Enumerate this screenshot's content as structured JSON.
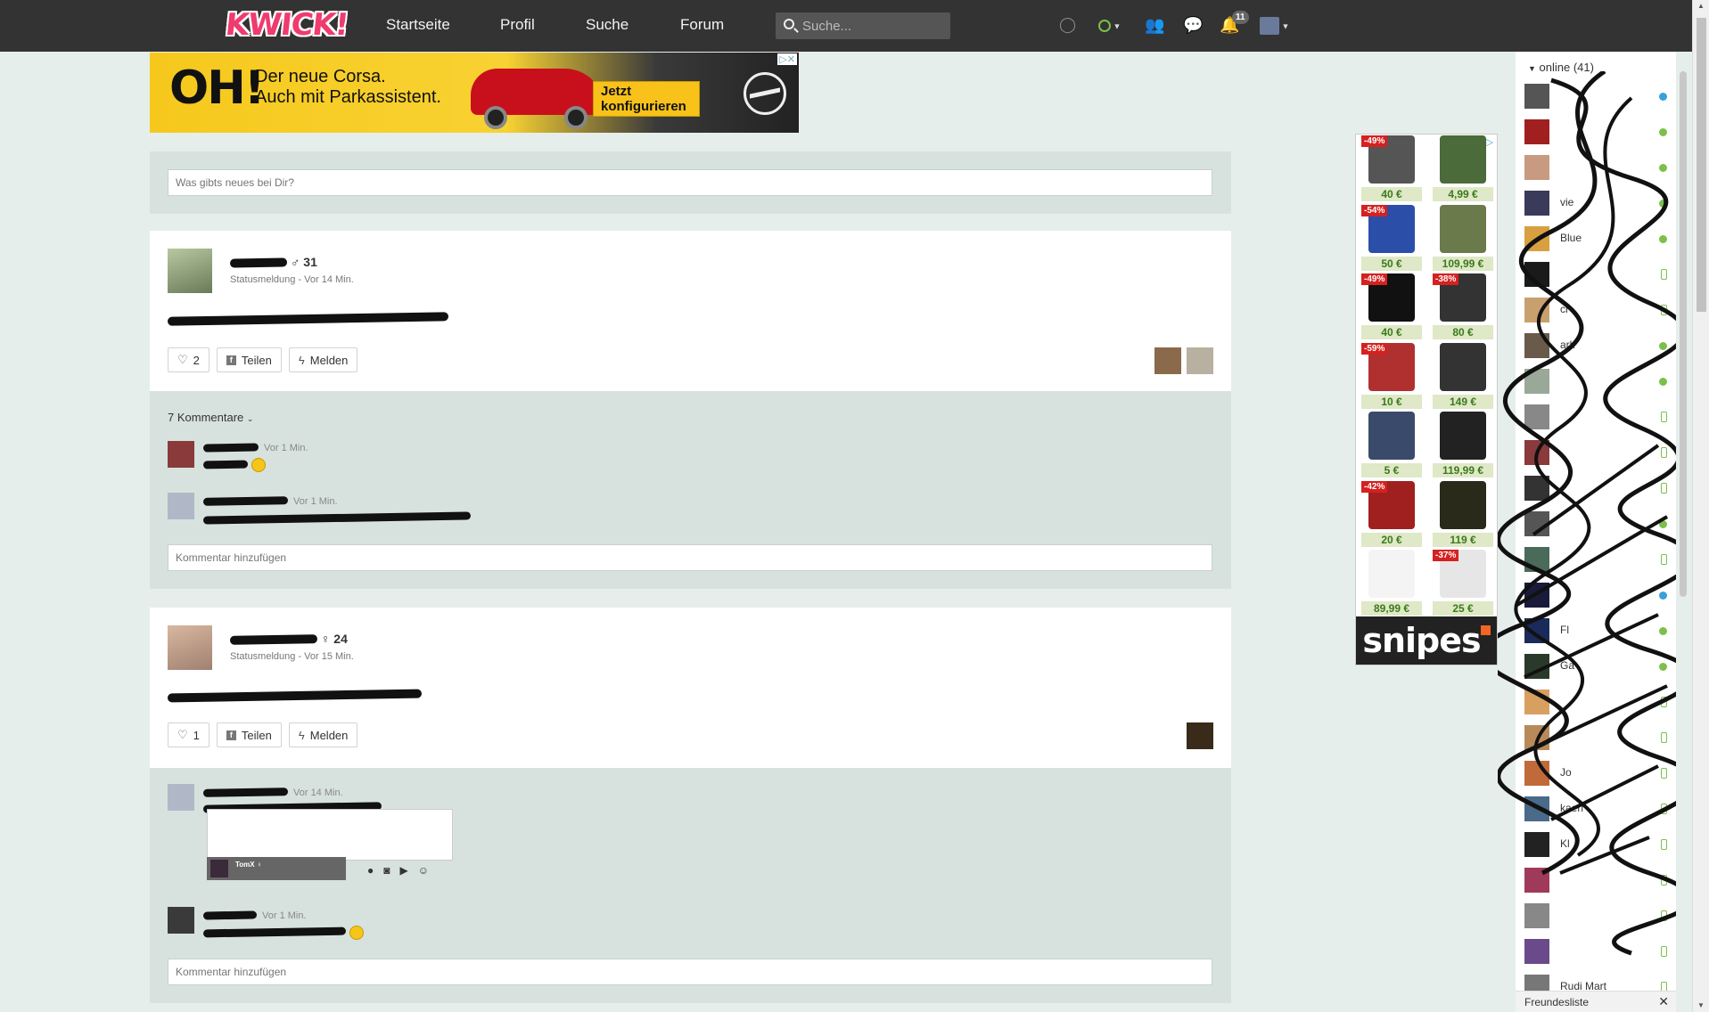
{
  "header": {
    "logo": "KWICK!",
    "nav": [
      "Startseite",
      "Profil",
      "Suche",
      "Forum"
    ],
    "search_placeholder": "Suche...",
    "notification_count": "11"
  },
  "ad_banner": {
    "headline": "OH!",
    "line1": "Der neue Corsa.",
    "line2": "Auch mit Parkassistent.",
    "cta": "Jetzt konfigurieren"
  },
  "compose": {
    "placeholder": "Was gibts neues bei Dir?"
  },
  "posts": [
    {
      "gender": "♂",
      "age": "31",
      "meta": "Statusmeldung - Vor 14 Min.",
      "likes": "2",
      "share_label": "Teilen",
      "report_label": "Melden",
      "comment_count": "7 Kommentare",
      "comments": [
        {
          "time": "Vor 1 Min."
        },
        {
          "time": "Vor 1 Min."
        }
      ],
      "comment_placeholder": "Kommentar hinzufügen"
    },
    {
      "gender": "♀",
      "age": "24",
      "meta": "Statusmeldung - Vor 15 Min.",
      "likes": "1",
      "share_label": "Teilen",
      "report_label": "Melden",
      "comments": [
        {
          "time": "Vor 14 Min.",
          "attachment_label": "TomX ♀"
        },
        {
          "time": "Vor 1 Min."
        }
      ],
      "comment_placeholder": "Kommentar hinzufügen"
    }
  ],
  "product_ad": {
    "brand": "snipes",
    "items": [
      {
        "price": "40 €",
        "discount": "-49%",
        "color": "#555"
      },
      {
        "price": "4,99 €",
        "discount": "",
        "color": "#4b6b3a"
      },
      {
        "price": "50 €",
        "discount": "-54%",
        "color": "#2b4fa8"
      },
      {
        "price": "109,99 €",
        "discount": "",
        "color": "#6b7a4a"
      },
      {
        "price": "40 €",
        "discount": "-49%",
        "color": "#111"
      },
      {
        "price": "80 €",
        "discount": "-38%",
        "color": "#333"
      },
      {
        "price": "10 €",
        "discount": "-59%",
        "color": "#b03030"
      },
      {
        "price": "149 €",
        "discount": "",
        "color": "#333"
      },
      {
        "price": "5 €",
        "discount": "",
        "color": "#3a4a6a"
      },
      {
        "price": "119,99 €",
        "discount": "",
        "color": "#222"
      },
      {
        "price": "20 €",
        "discount": "-42%",
        "color": "#a02020"
      },
      {
        "price": "119 €",
        "discount": "",
        "color": "#2a2a1a"
      },
      {
        "price": "89,99 €",
        "discount": "",
        "color": "#f4f4f4"
      },
      {
        "price": "25 €",
        "discount": "-37%",
        "color": "#e6e6e6"
      }
    ]
  },
  "friends_sidebar": {
    "header": "online (41)",
    "footer": "Freundesliste",
    "friends": [
      {
        "name": "",
        "status": "blue",
        "color": "#555"
      },
      {
        "name": "",
        "status": "online",
        "color": "#a02020"
      },
      {
        "name": "",
        "status": "online",
        "color": "#c89a80"
      },
      {
        "name": "vie",
        "status": "online",
        "color": "#3a3a5a"
      },
      {
        "name": "Blue",
        "status": "online",
        "color": "#d8a040"
      },
      {
        "name": "",
        "status": "mobile",
        "color": "#1a1a1a"
      },
      {
        "name": "ci",
        "status": "mobile",
        "color": "#c8a070"
      },
      {
        "name": "ark",
        "status": "online",
        "color": "#6a5a4a"
      },
      {
        "name": "",
        "status": "online",
        "color": "#9aa89a"
      },
      {
        "name": "",
        "status": "mobile",
        "color": "#888"
      },
      {
        "name": "",
        "status": "mobile",
        "color": "#8a3a3a"
      },
      {
        "name": "",
        "status": "mobile",
        "color": "#333"
      },
      {
        "name": "",
        "status": "online",
        "color": "#555"
      },
      {
        "name": "",
        "status": "mobile",
        "color": "#4a6a5a"
      },
      {
        "name": "",
        "status": "blue",
        "color": "#1a1a3a"
      },
      {
        "name": "Fl",
        "status": "online",
        "color": "#1a2a5a"
      },
      {
        "name": "Ga",
        "status": "online",
        "color": "#2a3a2a"
      },
      {
        "name": "",
        "status": "mobile",
        "color": "#d8a060"
      },
      {
        "name": "",
        "status": "mobile",
        "color": "#b88a5a"
      },
      {
        "name": "Jo",
        "status": "mobile",
        "color": "#c06a3a"
      },
      {
        "name": "kaerl",
        "status": "mobile",
        "color": "#4a6a8a"
      },
      {
        "name": "Kl",
        "status": "mobile",
        "color": "#222"
      },
      {
        "name": "",
        "status": "mobile",
        "color": "#a03a5a"
      },
      {
        "name": "",
        "status": "mobile",
        "color": "#888"
      },
      {
        "name": "",
        "status": "mobile",
        "color": "#6a4a8a"
      },
      {
        "name": "Rudi Mart",
        "status": "mobile",
        "color": "#777"
      }
    ]
  }
}
